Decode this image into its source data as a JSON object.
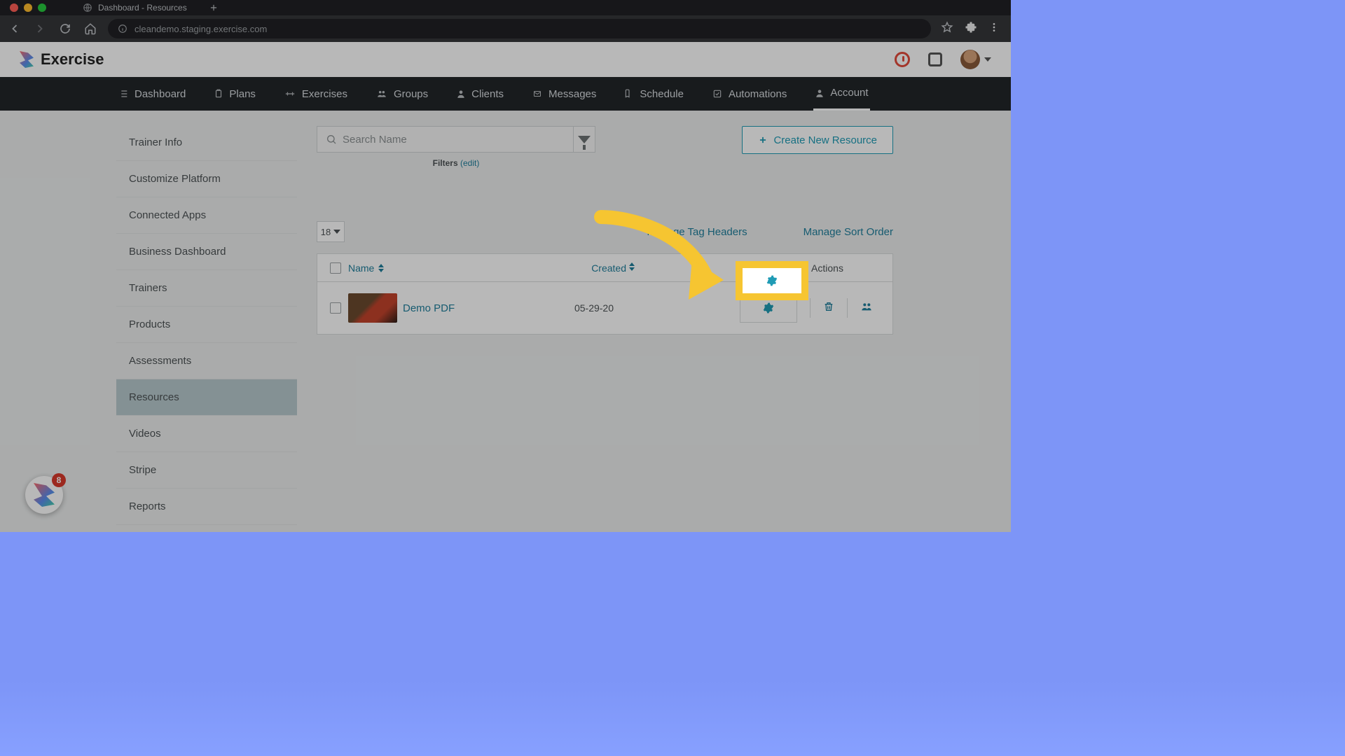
{
  "browser": {
    "tab_title": "Dashboard - Resources",
    "url": "cleandemo.staging.exercise.com"
  },
  "brand": {
    "name": "Exercise"
  },
  "nav": {
    "items": [
      "Dashboard",
      "Plans",
      "Exercises",
      "Groups",
      "Clients",
      "Messages",
      "Schedule",
      "Automations",
      "Account"
    ]
  },
  "sidebar": {
    "items": [
      "Trainer Info",
      "Customize Platform",
      "Connected Apps",
      "Business Dashboard",
      "Trainers",
      "Products",
      "Assessments",
      "Resources",
      "Videos",
      "Stripe",
      "Reports"
    ],
    "selected_index": 7
  },
  "toolbar": {
    "search_placeholder": "Search Name",
    "filters_label": "Filters",
    "filters_edit": "(edit)",
    "create_label": "Create New Resource"
  },
  "controls": {
    "page_size": "18",
    "manage_tags": "Manage Tag Headers",
    "manage_sort": "Manage Sort Order"
  },
  "table": {
    "col_name": "Name",
    "col_created": "Created",
    "col_actions": "Actions",
    "rows": [
      {
        "name": "Demo PDF",
        "created": "05-29-20"
      }
    ]
  },
  "chat_badge": "8"
}
